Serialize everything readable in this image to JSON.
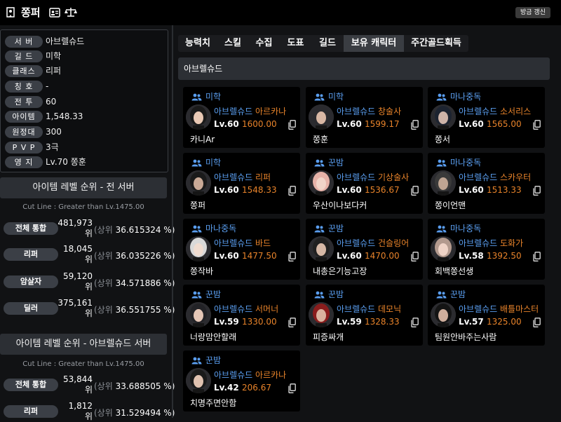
{
  "header": {
    "title": "쫑퍼",
    "refresh_label": "방금 갱신"
  },
  "info": [
    {
      "label": "서 버",
      "value": "아브렐슈드"
    },
    {
      "label": "길 드",
      "value": "미학"
    },
    {
      "label": "클래스",
      "value": "리퍼"
    },
    {
      "label": "칭 호",
      "value": "-"
    },
    {
      "label": "전 투",
      "value": "60"
    },
    {
      "label": "아이템",
      "value": "1,548.33"
    },
    {
      "label": "원정대",
      "value": "300"
    },
    {
      "label": "P V P",
      "value": "3극"
    },
    {
      "label": "영 지",
      "value": "Lv.70 쫑훈"
    }
  ],
  "rank_all": {
    "title": "아이템 레벨 순위 - 전 서버",
    "cutline": "Cut Line : Greater than Lv.1475.00",
    "rows": [
      {
        "label": "전체 통합",
        "num": "481,973",
        "unit": "위",
        "prefix": "(상위",
        "pct": "36.615324 %)"
      },
      {
        "label": "리퍼",
        "num": "18,045",
        "unit": "위",
        "prefix": "(상위",
        "pct": "36.035226 %)"
      },
      {
        "label": "암살자",
        "num": "59,120",
        "unit": "위",
        "prefix": "(상위",
        "pct": "34.571886 %)"
      },
      {
        "label": "딜러",
        "num": "375,161",
        "unit": "위",
        "prefix": "(상위",
        "pct": "36.551755 %)"
      }
    ]
  },
  "rank_server": {
    "title": "아이템 레벨 순위 - 아브렐슈드 서버",
    "cutline": "Cut Line : Greater than Lv.1475.00",
    "rows": [
      {
        "label": "전체 통합",
        "num": "53,844",
        "unit": "위",
        "prefix": "(상위",
        "pct": "33.688505 %)"
      },
      {
        "label": "리퍼",
        "num": "1,812",
        "unit": "위",
        "prefix": "(상위",
        "pct": "31.529494 %)"
      }
    ]
  },
  "tabs": [
    "능력치",
    "스킬",
    "수집",
    "도표",
    "길드",
    "보유 캐릭터",
    "주간골드획득"
  ],
  "active_tab": "보유 캐릭터",
  "server_bar": "아브렐슈드",
  "colors": {
    "guild_blue": "#5a9ef0",
    "class_orange": "#e8832a"
  },
  "characters": [
    {
      "guild": "미학",
      "server": "아브렐슈드",
      "class": "아르카나",
      "level": "Lv.60",
      "item": "1600.00",
      "name": "카니Ar",
      "hair": "#1a1a1a",
      "skin": "#e9c9b5"
    },
    {
      "guild": "미학",
      "server": "아브렐슈드",
      "class": "창술사",
      "level": "Lv.60",
      "item": "1599.17",
      "name": "쫑훈",
      "hair": "#2a2a2e",
      "skin": "#d8b7a4"
    },
    {
      "guild": "마나중독",
      "server": "아브렐슈드",
      "class": "소서리스",
      "level": "Lv.60",
      "item": "1565.00",
      "name": "쫑서",
      "hair": "#1c2330",
      "skin": "#cdb3a8"
    },
    {
      "guild": "미학",
      "server": "아브렐슈드",
      "class": "리퍼",
      "level": "Lv.60",
      "item": "1548.33",
      "name": "쫑퍼",
      "hair": "#1a1a1a",
      "skin": "#c9a996"
    },
    {
      "guild": "꾼밤",
      "server": "아브렐슈드",
      "class": "기상술사",
      "level": "Lv.60",
      "item": "1536.67",
      "name": "우산이나보다커",
      "hair": "#e6b2a8",
      "skin": "#f1d4c8"
    },
    {
      "guild": "마나중독",
      "server": "아브렐슈드",
      "class": "스카우터",
      "level": "Lv.60",
      "item": "1513.33",
      "name": "쫑이언맨",
      "hair": "#3a3a3a",
      "skin": "#bfa593"
    },
    {
      "guild": "마나중독",
      "server": "아브렐슈드",
      "class": "바드",
      "level": "Lv.60",
      "item": "1477.50",
      "name": "쫑작바",
      "hair": "#d9d9d9",
      "skin": "#f0dcd0"
    },
    {
      "guild": "꾼밤",
      "server": "아브렐슈드",
      "class": "건슬링어",
      "level": "Lv.60",
      "item": "1470.00",
      "name": "내총은기능고장",
      "hair": "#202020",
      "skin": "#d6b8a6"
    },
    {
      "guild": "마나중독",
      "server": "아브렐슈드",
      "class": "도화가",
      "level": "Lv.58",
      "item": "1392.50",
      "name": "회백쫑선생",
      "hair": "#b39a8e",
      "skin": "#efd3c6"
    },
    {
      "guild": "꾼밤",
      "server": "아브렐슈드",
      "class": "서머너",
      "level": "Lv.59",
      "item": "1330.00",
      "name": "너랑맘안할래",
      "hair": "#222226",
      "skin": "#e4c6b6"
    },
    {
      "guild": "꾼밤",
      "server": "아브렐슈드",
      "class": "데모닉",
      "level": "Lv.59",
      "item": "1328.33",
      "name": "피증싸개",
      "hair": "#8a1d1d",
      "skin": "#dab39f"
    },
    {
      "guild": "꾼밤",
      "server": "아브렐슈드",
      "class": "배틀마스터",
      "level": "Lv.57",
      "item": "1325.00",
      "name": "팀원안바주는사람",
      "hair": "#141414",
      "skin": "#cfae9c"
    },
    {
      "guild": "꾼밤",
      "server": "아브렐슈드",
      "class": "아르카나",
      "level": "Lv.42",
      "item": "206.67",
      "name": "치명주면안함",
      "hair": "#1a1a1a",
      "skin": "#e0c2b0"
    }
  ]
}
